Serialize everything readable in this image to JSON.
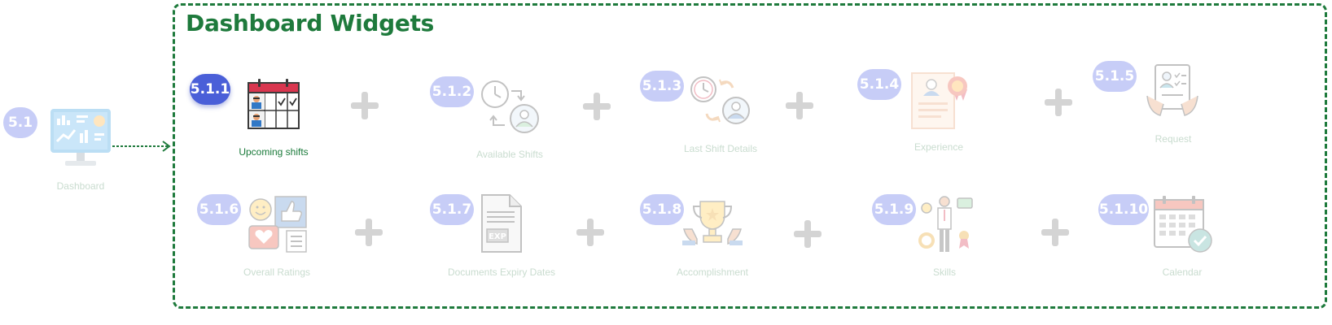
{
  "root": {
    "badge": "5.1",
    "label": "Dashboard",
    "icon": "monitor-dashboard-icon"
  },
  "section_title": "Dashboard Widgets",
  "widgets": [
    {
      "badge": "5.1.1",
      "label": "Upcoming shifts",
      "icon": "calendar-shifts-icon",
      "active": true
    },
    {
      "badge": "5.1.2",
      "label": "Available Shifts",
      "icon": "clock-user-icon"
    },
    {
      "badge": "5.1.3",
      "label": "Last Shift Details",
      "icon": "clock-history-user-icon"
    },
    {
      "badge": "5.1.4",
      "label": "Experience",
      "icon": "certificate-icon"
    },
    {
      "badge": "5.1.5",
      "label": "Request",
      "icon": "request-form-icon"
    },
    {
      "badge": "5.1.6",
      "label": "Overall Ratings",
      "icon": "ratings-feedback-icon"
    },
    {
      "badge": "5.1.7",
      "label": "Documents Expiry Dates",
      "icon": "document-exp-icon"
    },
    {
      "badge": "5.1.8",
      "label": "Accomplishment",
      "icon": "trophy-icon"
    },
    {
      "badge": "5.1.9",
      "label": "Skills",
      "icon": "skills-person-icon"
    },
    {
      "badge": "5.1.10",
      "label": "Calendar",
      "icon": "calendar-check-icon"
    }
  ],
  "colors": {
    "accent_green": "#1e7a3c",
    "badge_active": "#4a5fd8",
    "badge_inactive": "#c7cdf7"
  }
}
